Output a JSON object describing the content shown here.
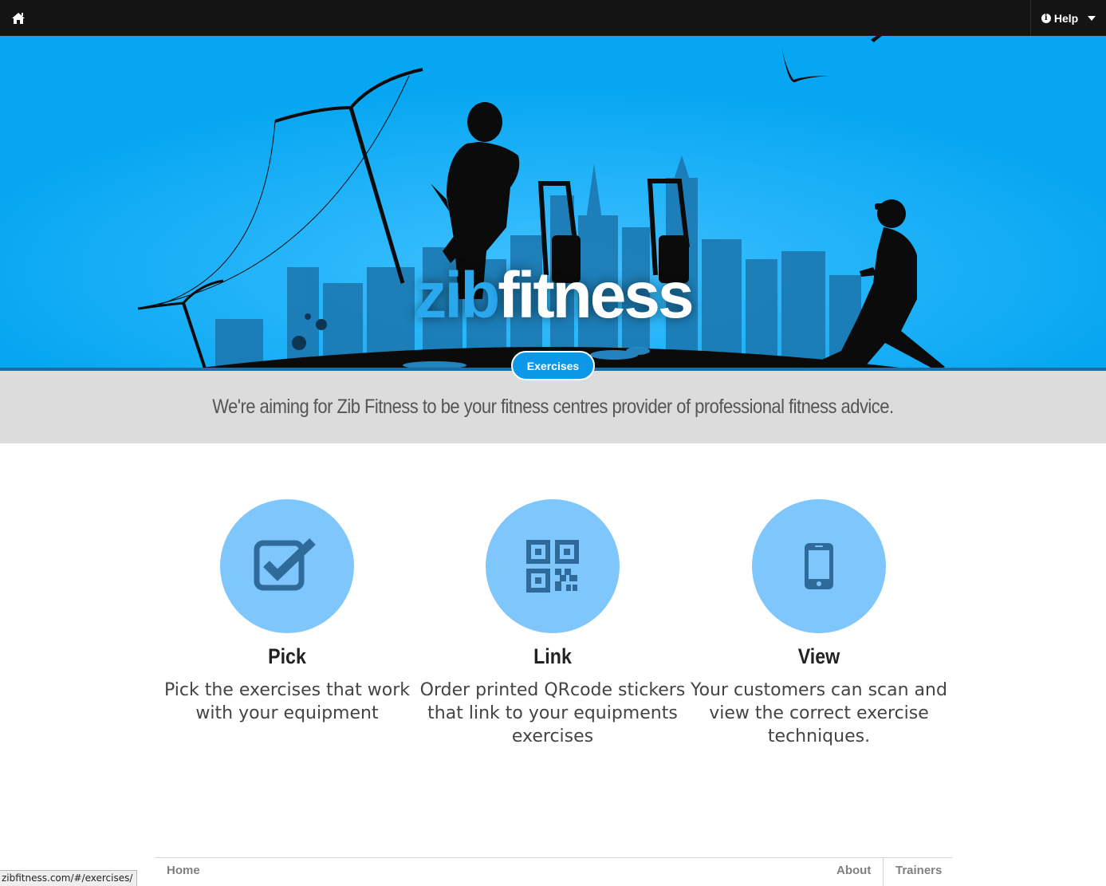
{
  "nav": {
    "home_icon": "home-icon",
    "help_label": "Help",
    "help_icon": "info-circle-icon"
  },
  "hero": {
    "logo_zib": "zib",
    "logo_fitness": "fitness",
    "exercises_button": "Exercises"
  },
  "tagline": "We're aiming for Zib Fitness to be your fitness centres provider of professional fitness advice.",
  "features": [
    {
      "icon": "checkbox-icon",
      "title": "Pick",
      "text": "Pick the exercises that work with your equipment"
    },
    {
      "icon": "qrcode-icon",
      "title": "Link",
      "text": "Order printed QRcode stickers that link to your equipments exercises"
    },
    {
      "icon": "mobile-phone-icon",
      "title": "View",
      "text": "Your customers can scan and view the correct exercise techniques."
    }
  ],
  "footer": {
    "home": "Home",
    "about": "About",
    "trainers": "Trainers"
  },
  "status_url": "zibfitness.com/#/exercises/",
  "colors": {
    "hero_blue": "#06a6f2",
    "accent_blue": "#0d97e8",
    "circle_blue": "#7ec6fb",
    "icon_blue": "#2f6b9a",
    "nav_dark": "#141414",
    "tagline_bg": "#dcdcdc"
  }
}
